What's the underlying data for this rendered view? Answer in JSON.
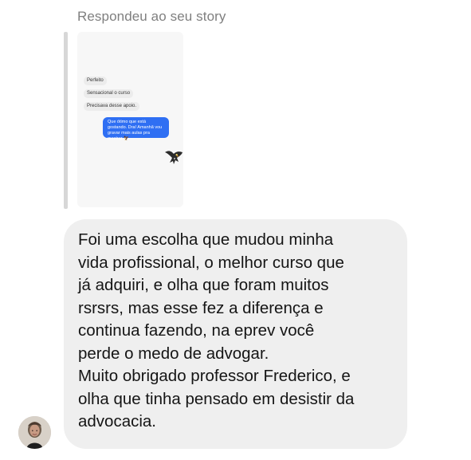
{
  "story_reply": {
    "header": "Respondeu ao seu story"
  },
  "story_preview": {
    "messages_in": [
      "Perfeito",
      "Sensacional o curso",
      "Precisava desse apoio."
    ],
    "message_out": "Que ótimo que está gostando. Dra! Amanhã vou gravar mais aulas pra mostrar 🦅"
  },
  "reply": {
    "lines": [
      "Foi uma escolha que mudou minha",
      "vida profissional, o melhor curso que",
      "já adquiri, e olha que foram muitos",
      "rsrsrs, mas esse fez a diferença e",
      "continua fazendo, na eprev você",
      "perde o medo de advogar.",
      "Muito obrigado professor Frederico, e",
      "olha que tinha pensado em desistir da",
      "advocacia."
    ]
  },
  "icons": {
    "avatar": "user-photo",
    "sticker": "eagle-icon"
  },
  "colors": {
    "message_out": "#2f6ff3",
    "bubble": "#efefef",
    "muted_text": "#7f7f7f"
  }
}
